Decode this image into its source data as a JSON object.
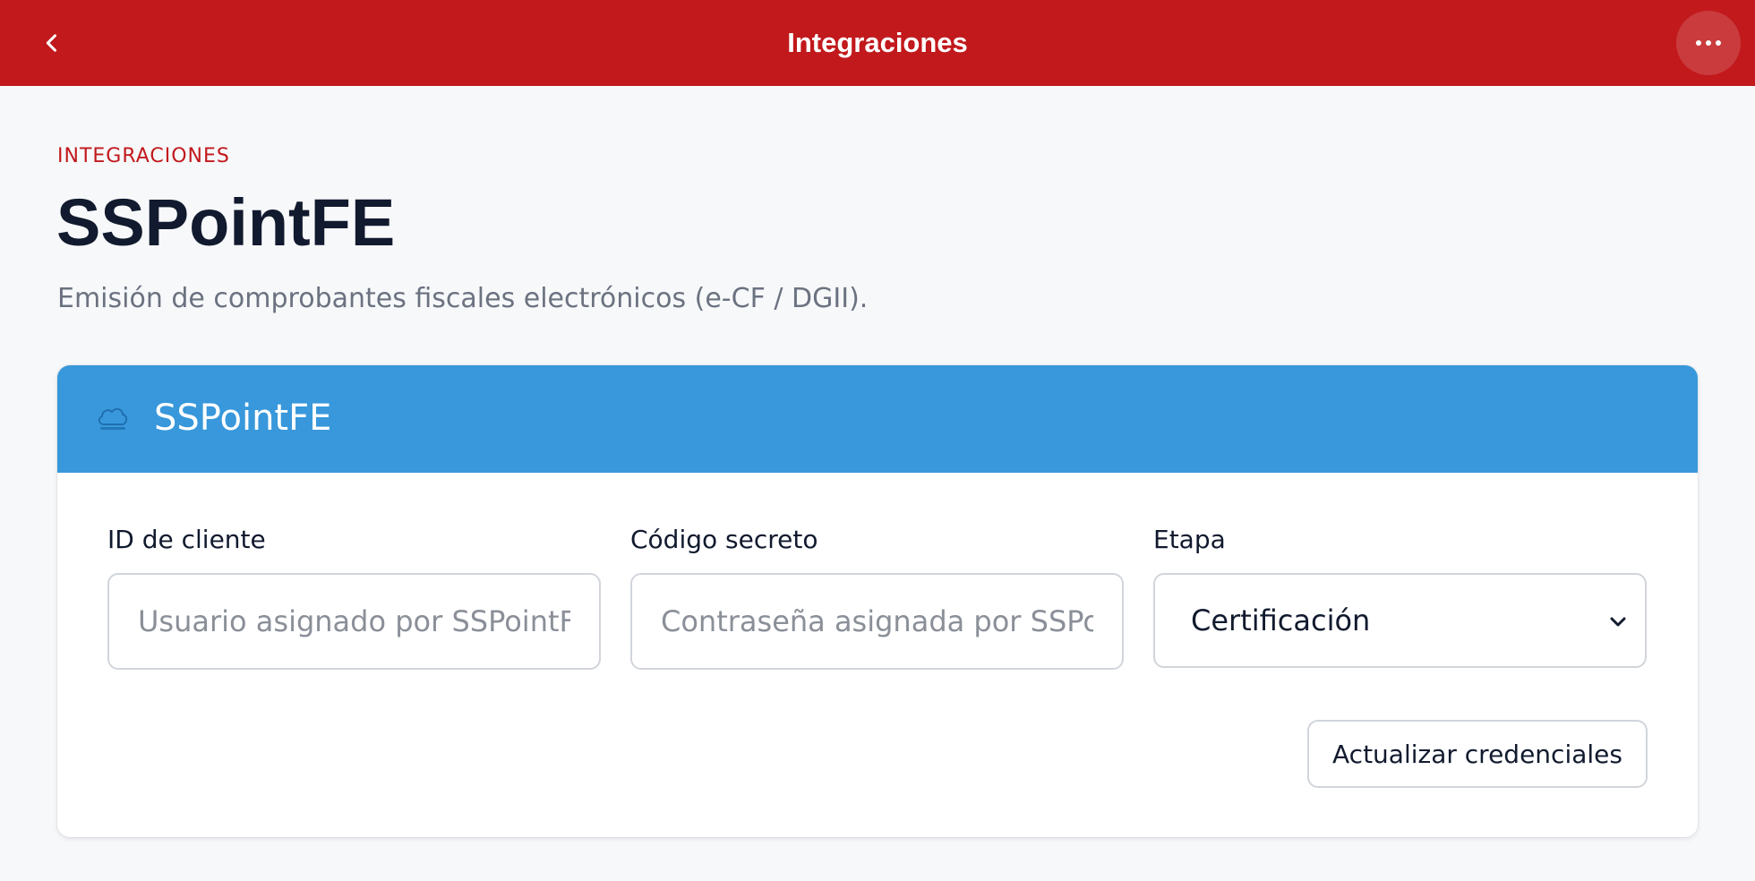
{
  "topbar": {
    "title": "Integraciones",
    "back_icon": "chevron-left-icon",
    "more_icon": "more-horizontal-icon",
    "color": "#c1191c"
  },
  "page": {
    "eyebrow": "INTEGRACIONES",
    "title": "SSPointFE",
    "subtitle": "Emisión de comprobantes fiscales electrónicos (e-CF / DGII)."
  },
  "card": {
    "header_color": "#3898db",
    "logo_icon": "cloud-logo-icon",
    "title": "SSPointFE",
    "fields": {
      "client_id": {
        "label": "ID de cliente",
        "value": "",
        "placeholder": "Usuario asignado por SSPointFE"
      },
      "secret": {
        "label": "Código secreto",
        "value": "",
        "placeholder": "Contraseña asignada por SSPointFE"
      },
      "stage": {
        "label": "Etapa",
        "selected": "Certificación",
        "icon": "chevron-down-icon"
      }
    },
    "update_button": "Actualizar credenciales"
  }
}
